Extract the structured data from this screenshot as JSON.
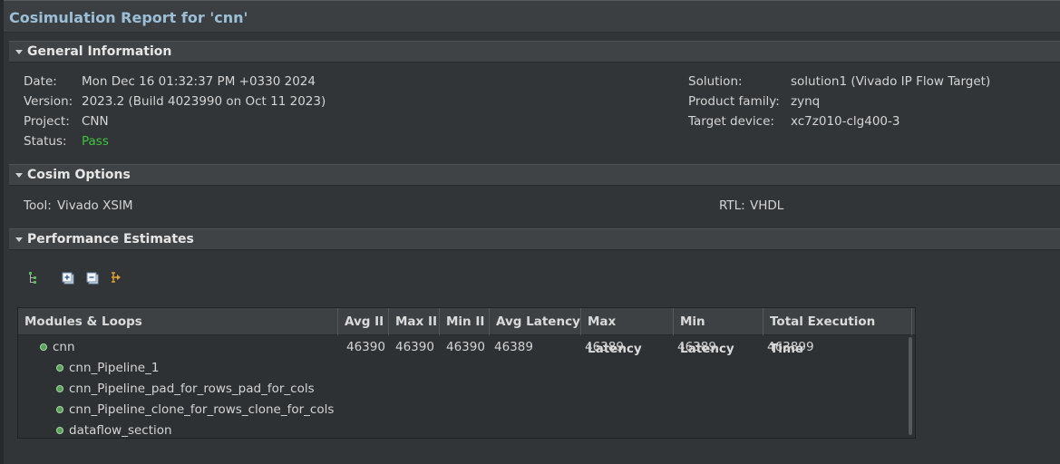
{
  "title": "Cosimulation Report for 'cnn'",
  "general": {
    "header": "General Information",
    "date_label": "Date:",
    "date_value": "Mon Dec 16 01:32:37 PM +0330 2024",
    "version_label": "Version:",
    "version_value": "2023.2 (Build 4023990 on Oct 11 2023)",
    "project_label": "Project:",
    "project_value": "CNN",
    "status_label": "Status:",
    "status_value": "Pass",
    "solution_label": "Solution:",
    "solution_value": "solution1 (Vivado IP Flow Target)",
    "family_label": "Product family:",
    "family_value": "zynq",
    "device_label": "Target device:",
    "device_value": "xc7z010-clg400-3"
  },
  "cosim": {
    "header": "Cosim Options",
    "tool_label": "Tool:",
    "tool_value": "Vivado XSIM",
    "rtl_label": "RTL:",
    "rtl_value": "VHDL"
  },
  "perf": {
    "header": "Performance Estimates",
    "columns": [
      "Modules & Loops",
      "Avg II",
      "Max II",
      "Min II",
      "Avg Latency",
      "Max Latency",
      "Min Latency",
      "Total Execution Time"
    ],
    "rows": [
      {
        "name": "cnn",
        "values": [
          "46390",
          "46390",
          "46390",
          "46389",
          "46389",
          "46389",
          "463899"
        ]
      },
      {
        "name": "cnn_Pipeline_1",
        "values": [
          "",
          "",
          "",
          "",
          "",
          "",
          ""
        ]
      },
      {
        "name": "cnn_Pipeline_pad_for_rows_pad_for_cols",
        "values": [
          "",
          "",
          "",
          "",
          "",
          "",
          ""
        ]
      },
      {
        "name": "cnn_Pipeline_clone_for_rows_clone_for_cols",
        "values": [
          "",
          "",
          "",
          "",
          "",
          "",
          ""
        ]
      },
      {
        "name": "dataflow_section",
        "values": [
          "",
          "",
          "",
          "",
          "",
          "",
          ""
        ]
      }
    ]
  },
  "colors": {
    "status_pass": "#3ec43e",
    "title": "#9cbfd8"
  },
  "icons": [
    "tree-hierarchy-icon",
    "expand-all-icon",
    "collapse-all-icon",
    "show-in-flow-icon"
  ]
}
